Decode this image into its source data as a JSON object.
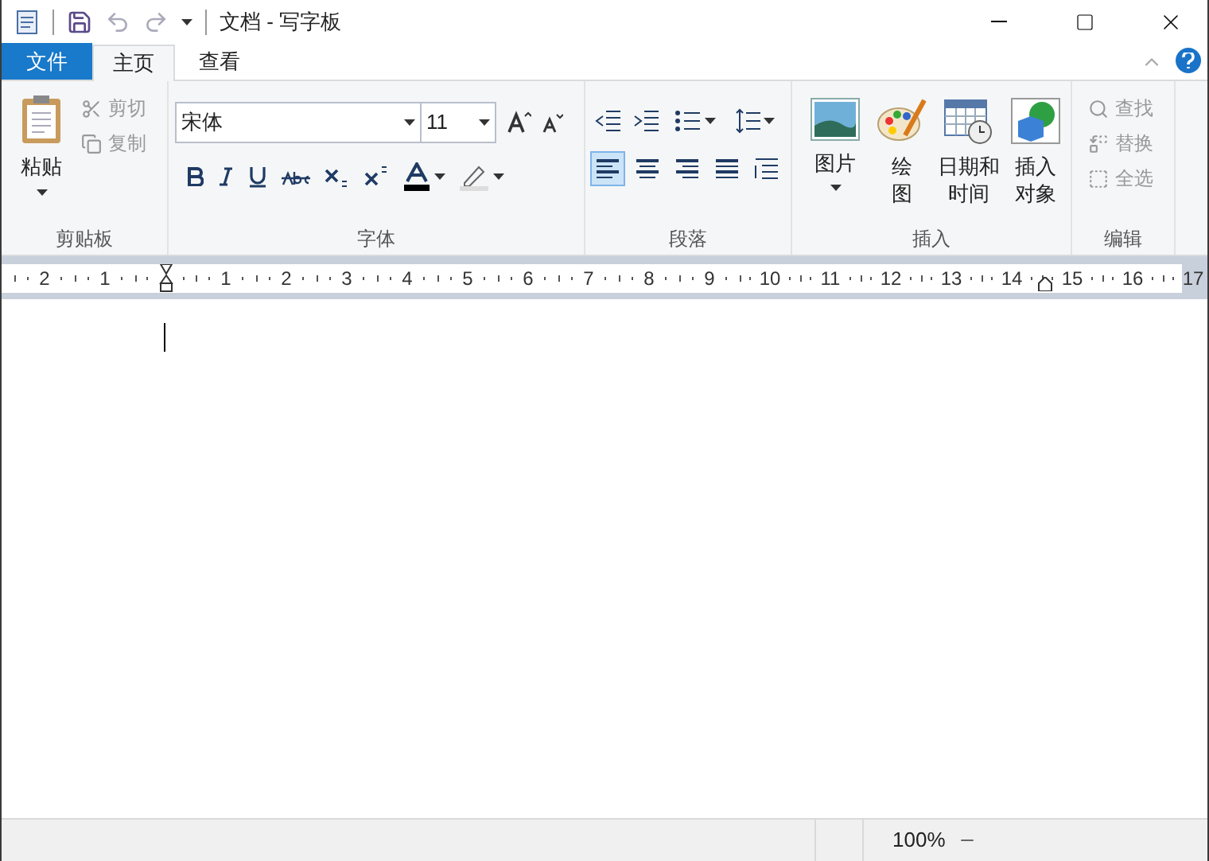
{
  "window": {
    "title": "文档 - 写字板"
  },
  "tabs": [
    {
      "label": "文件",
      "kind": "file",
      "selected": false
    },
    {
      "label": "主页",
      "kind": "tab",
      "selected": true
    },
    {
      "label": "查看",
      "kind": "tab",
      "selected": false
    }
  ],
  "clipboard": {
    "label": "剪贴板",
    "paste": "粘贴",
    "cut": {
      "label": "剪切",
      "disabled": true
    },
    "copy": {
      "label": "复制",
      "disabled": true
    }
  },
  "font": {
    "label": "字体",
    "family": "宋体",
    "size": "11"
  },
  "paragraph": {
    "label": "段落",
    "alignments": [
      {
        "kind": "left",
        "selected": true
      },
      {
        "kind": "center",
        "selected": false
      },
      {
        "kind": "right",
        "selected": false
      },
      {
        "kind": "justify",
        "selected": false
      }
    ]
  },
  "insert": {
    "label": "插入",
    "items": [
      {
        "kind": "picture",
        "label": "图片",
        "dropdown": true
      },
      {
        "kind": "paint",
        "label": "绘图",
        "dropdown": false
      },
      {
        "kind": "datetime",
        "label": "日期和时间",
        "dropdown": false
      },
      {
        "kind": "object",
        "label": "插入对象",
        "dropdown": false
      }
    ]
  },
  "editing": {
    "label": "编辑",
    "items": [
      {
        "kind": "find",
        "label": "查找",
        "disabled": true
      },
      {
        "kind": "replace",
        "label": "替换",
        "disabled": true
      },
      {
        "kind": "selectall",
        "label": "全选",
        "disabled": true
      }
    ]
  },
  "ruler": {
    "left_labels": [
      "2",
      "1"
    ],
    "labels": [
      "1",
      "2",
      "3",
      "4",
      "5",
      "6",
      "7",
      "8",
      "9",
      "10",
      "11",
      "12",
      "13",
      "14",
      "15",
      "16",
      "17"
    ]
  },
  "status_bar": {
    "zoom": "100%"
  }
}
